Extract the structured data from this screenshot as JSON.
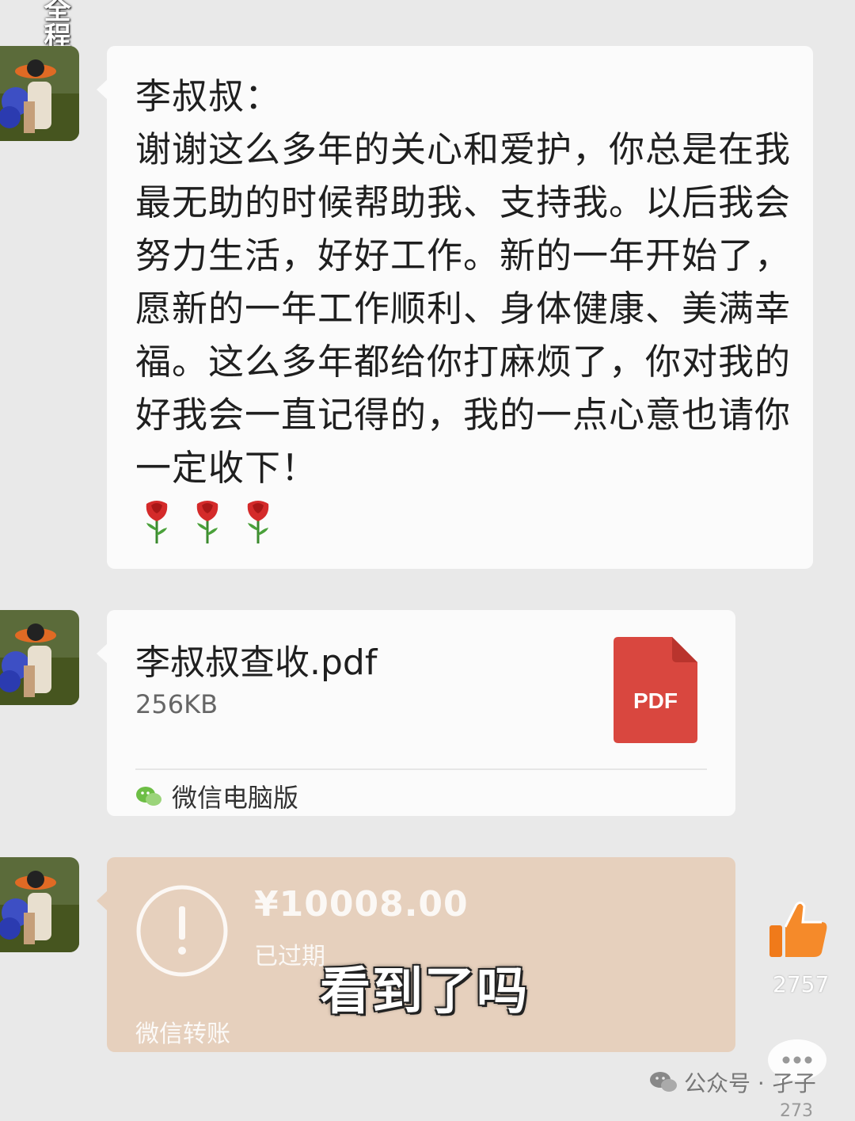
{
  "watermark_text": "全程拍摄",
  "messages": {
    "greeting_message": {
      "text": "李叔叔：\n谢谢这么多年的关心和爱护，你总是在我最无助的时候帮助我、支持我。以后我会努力生活，好好工作。新的一年开始了，愿新的一年工作顺利、身体健康、美满幸福。这么多年都给你打麻烦了，你对我的好我会一直记得的，我的一点心意也请你一定收下！",
      "emoji": [
        "rose",
        "rose",
        "rose"
      ]
    },
    "file_message": {
      "file_name": "李叔叔查收.pdf",
      "file_size": "256KB",
      "file_type_label": "PDF",
      "source_label": "微信电脑版"
    },
    "transfer_message": {
      "amount": "¥10008.00",
      "status": "已过期",
      "label": "微信转账"
    }
  },
  "overlay": {
    "caption": "看到了吗",
    "like_count": "2757"
  },
  "footer": {
    "account_text": "公众号 · 孑子",
    "sub_text": "273"
  },
  "colors": {
    "bubble": "#fbfbfb",
    "transfer_bubble": "#e6d0bd",
    "pdf_red": "#d9473f",
    "like_orange": "#f07a1a"
  }
}
